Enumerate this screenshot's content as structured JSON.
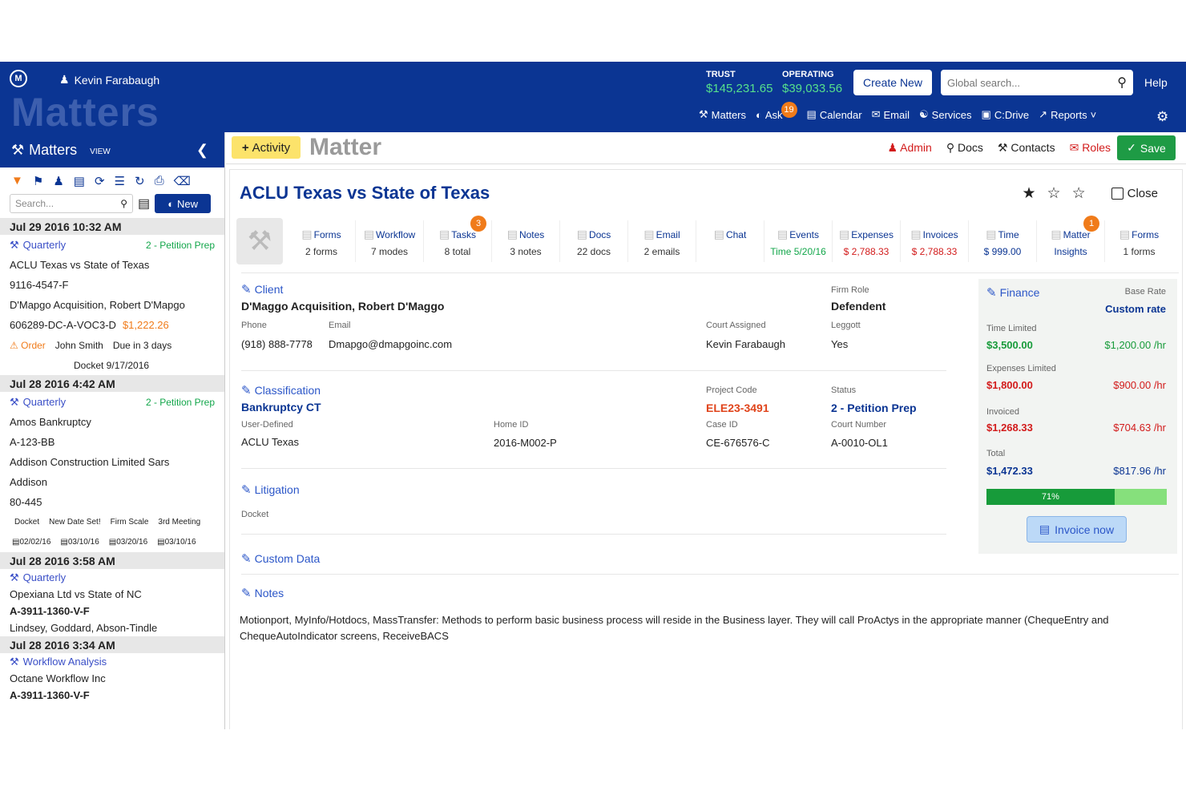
{
  "header": {
    "user": "Kevin Farabaugh",
    "watermark": "Matters",
    "trust_label": "TRUST",
    "trust_value": "$145,231.65",
    "operating_label": "OPERATING",
    "operating_value": "$39,033.56",
    "create_new": "Create New",
    "search_placeholder": "Global search...",
    "help": "Help",
    "nav": [
      {
        "label": "Matters"
      },
      {
        "label": "Ask",
        "badge": "19"
      },
      {
        "label": "Calendar"
      },
      {
        "label": "Email"
      },
      {
        "label": "Services"
      },
      {
        "label": "C:Drive"
      },
      {
        "label": "Reports"
      }
    ]
  },
  "sidebar": {
    "title": "Matters",
    "view": "VIEW",
    "search_placeholder": "Search...",
    "new_label": "New",
    "g1": {
      "date": "Jul 29 2016 10:32 AM",
      "type": "Quarterly",
      "stage": "2 - Petition Prep",
      "name": "ACLU Texas vs State of Texas",
      "num": "9116-4547-F",
      "client": "D'Mapgo Acquisition, Robert D'Mapgo",
      "code": "606289-DC-A-VOC3-D",
      "amount": "$1,222.26",
      "order": "Order",
      "person": "John Smith",
      "due": "Due in 3 days",
      "docket": "Docket 9/17/2016"
    },
    "g2": {
      "date": "Jul 28 2016 4:42 AM",
      "type": "Quarterly",
      "stage": "2 - Petition Prep",
      "name": "Amos Bankruptcy",
      "num": "A-123-BB",
      "client": "Addison Construction Limited Sars",
      "city": "Addison",
      "code": "80-445",
      "mini_labels": [
        "Docket",
        "New Date Set!",
        "Firm Scale",
        "3rd Meeting"
      ],
      "mini_dates": [
        "02/02/16",
        "03/10/16",
        "03/20/16",
        "03/10/16"
      ]
    },
    "g3": {
      "date": "Jul 28 2016 3:58 AM",
      "type": "Quarterly",
      "name": "Opexiana Ltd vs State of NC",
      "num": "A-3911-1360-V-F",
      "client": "Lindsey, Goddard, Abson-Tindle"
    },
    "g4": {
      "date": "Jul 28 2016 3:34 AM",
      "type": "Workflow Analysis",
      "name": "Octane Workflow Inc",
      "num": "A-3911-1360-V-F"
    }
  },
  "toolbar": {
    "activity": "Activity",
    "title": "Matter",
    "admin": "Admin",
    "docs": "Docs",
    "contacts": "Contacts",
    "roles": "Roles",
    "save": "Save"
  },
  "matter": {
    "title": "ACLU Texas vs State of Texas",
    "close": "Close",
    "tabs": [
      {
        "label": "Forms",
        "value": "2 forms"
      },
      {
        "label": "Workflow",
        "value": "7 modes"
      },
      {
        "label": "Tasks",
        "value": "8 total",
        "badge": "3"
      },
      {
        "label": "Notes",
        "value": "3 notes"
      },
      {
        "label": "Docs",
        "value": "22 docs"
      },
      {
        "label": "Email",
        "value": "2 emails"
      },
      {
        "label": "Chat",
        "value": ""
      },
      {
        "label": "Events",
        "value": "Time 5/20/16"
      },
      {
        "label": "Expenses",
        "value": "$ 2,788.33"
      },
      {
        "label": "Invoices",
        "value": "$ 2,788.33"
      },
      {
        "label": "Time",
        "value": "$ 999.00"
      },
      {
        "label": "Matter",
        "value": "Insights",
        "badge": "1"
      },
      {
        "label": "Forms",
        "value": "1 forms"
      }
    ],
    "client": {
      "section": "Client",
      "name": "D'Maggo Acquisition, Robert D'Maggo",
      "phone_label": "Phone",
      "phone": "(918) 888-7778",
      "email_label": "Email",
      "email": "Dmapgo@dmapgoinc.com",
      "court_label": "Court Assigned",
      "court": "Kevin Farabaugh",
      "role_label": "Firm Role",
      "role": "Defendent",
      "leggott_label": "Leggott",
      "leggott": "Yes"
    },
    "classification": {
      "section": "Classification",
      "name": "Bankruptcy CT",
      "ud_label": "User-Defined",
      "ud": "ACLU Texas",
      "home_label": "Home ID",
      "home": "2016-M002-P",
      "pc_label": "Project Code",
      "pc": "ELE23-3491",
      "case_label": "Case ID",
      "case": "CE-676576-C",
      "status_label": "Status",
      "status": "2 - Petition Prep",
      "cn_label": "Court Number",
      "cn": "A-0010-OL1"
    },
    "litigation": {
      "section": "Litigation",
      "docket": "Docket"
    },
    "custom": {
      "section": "Custom Data"
    },
    "notes": {
      "section": "Notes",
      "text": "Motionport, MyInfo/Hotdocs, MassTransfer: Methods to perform basic business process will reside in the Business layer. They will call ProActys in the appropriate manner (ChequeEntry and ChequeAutoIndicator screens, ReceiveBACS"
    },
    "finance": {
      "section": "Finance",
      "base_label": "Base Rate",
      "base": "Custom rate",
      "tl_label": "Time Limited",
      "tl": "$3,500.00",
      "tl_rate": "$1,200.00 /hr",
      "el_label": "Expenses Limited",
      "el": "$1,800.00",
      "el_rate": "$900.00 /hr",
      "inv_label": "Invoiced",
      "inv": "$1,268.33",
      "inv_rate": "$704.63 /hr",
      "tot_label": "Total",
      "tot": "$1,472.33",
      "tot_rate": "$817.96 /hr",
      "progress": 0.71,
      "progress_label": "71%",
      "invoice_now": "Invoice now"
    }
  }
}
